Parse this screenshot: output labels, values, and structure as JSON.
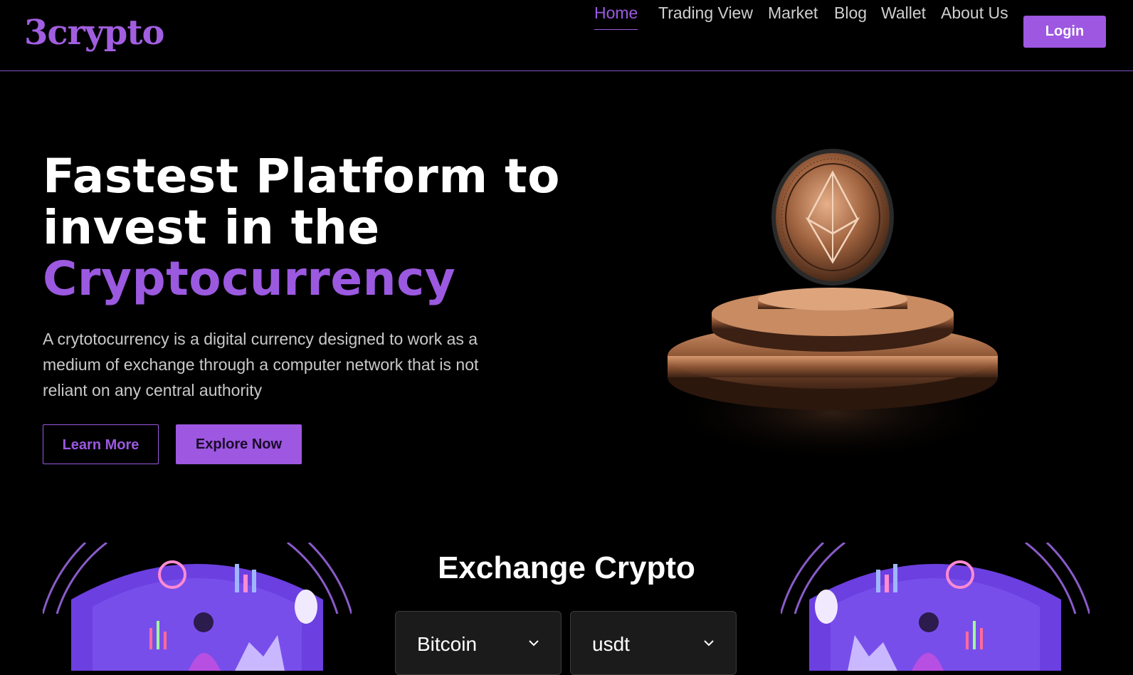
{
  "brand": {
    "logo_text": "3crypto",
    "accent_color": "#9d57e0"
  },
  "nav": {
    "links": [
      {
        "label": "Home",
        "active": true
      },
      {
        "label": "Trading View",
        "active": false
      },
      {
        "label": "Market",
        "active": false
      },
      {
        "label": "Blog",
        "active": false
      },
      {
        "label": "Wallet",
        "active": false
      },
      {
        "label": "About Us",
        "active": false
      }
    ],
    "login_label": "Login"
  },
  "hero": {
    "title_line1": "Fastest Platform to",
    "title_line2": "invest in the",
    "title_accent": "Cryptocurrency",
    "description": "A crytotocurrency is a digital currency designed to work as a medium of exchange through a computer network that is not reliant on any central authority",
    "learn_more_label": "Learn More",
    "explore_label": "Explore Now",
    "illustration_icon": "ethereum-coin-on-pedestal"
  },
  "exchange": {
    "title": "Exchange Crypto",
    "from_selected": "Bitcoin",
    "to_selected": "usdt",
    "side_illustration_icon": "trader-dashboard-illustration"
  }
}
